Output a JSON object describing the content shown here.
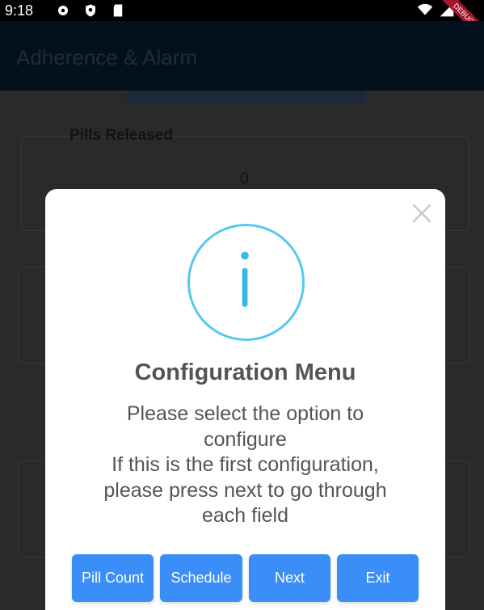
{
  "status_bar": {
    "time": "9:18",
    "icons": [
      "gear-icon",
      "shield-icon",
      "sd-card-icon",
      "wifi-icon",
      "signal-icon"
    ],
    "debug_label": "DEBUG"
  },
  "app_bar": {
    "title": "Adherence & Alarm"
  },
  "background": {
    "pills_label": "Pills Released",
    "pills_value": "0"
  },
  "dialog": {
    "icon": "info-icon",
    "accent_color": "#55c8ee",
    "title": "Configuration Menu",
    "body_lines": [
      "Please select the option to",
      "configure",
      "If this is the first configuration,",
      "please press next to go through",
      "each field"
    ],
    "buttons": {
      "pill_count": "Pill Count",
      "schedule": "Schedule",
      "next": "Next",
      "exit": "Exit"
    },
    "button_color": "#3b8ef7"
  }
}
